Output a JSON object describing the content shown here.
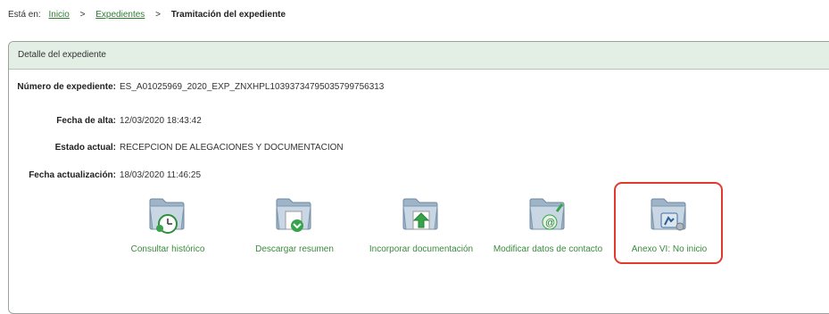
{
  "breadcrumb": {
    "prefix": "Está en:",
    "items": [
      "Inicio",
      "Expedientes"
    ],
    "current": "Tramitación del expediente",
    "separator": ">"
  },
  "panel": {
    "title": "Detalle del expediente",
    "fields": [
      {
        "label": "Número de expediente:",
        "value": "ES_A01025969_2020_EXP_ZNXHPL10393734795035799756313"
      },
      {
        "label": "Fecha de alta:",
        "value": "12/03/2020 18:43:42"
      },
      {
        "label": "Estado actual:",
        "value": "RECEPCION DE ALEGACIONES Y DOCUMENTACION"
      },
      {
        "label": "Fecha actualización:",
        "value": "18/03/2020 11:46:25"
      }
    ]
  },
  "actions": [
    {
      "label": "Consultar histórico",
      "icon": "folder-clock-icon"
    },
    {
      "label": "Descargar resumen",
      "icon": "folder-download-icon"
    },
    {
      "label": "Incorporar documentación",
      "icon": "folder-upload-icon"
    },
    {
      "label": "Modificar datos de contacto",
      "icon": "folder-email-icon"
    },
    {
      "label": "Anexo VI: No inicio",
      "icon": "folder-worker-icon"
    }
  ],
  "colors": {
    "link": "#2e7d32",
    "header_bg": "#e3eee4",
    "highlight": "#e03a2f"
  }
}
